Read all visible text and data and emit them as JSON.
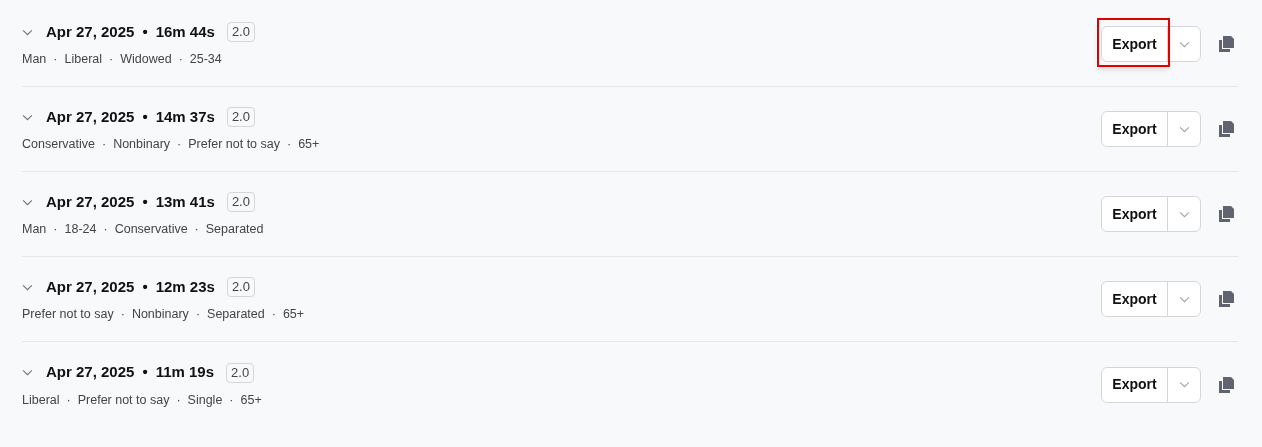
{
  "title_separator": "•",
  "tag_separator": "·",
  "sessions": [
    {
      "date": "Apr 27, 2025",
      "duration": "16m 44s",
      "version": "2.0",
      "tags": [
        "Man",
        "Liberal",
        "Widowed",
        "25-34"
      ],
      "export_label": "Export",
      "highlighted": true
    },
    {
      "date": "Apr 27, 2025",
      "duration": "14m 37s",
      "version": "2.0",
      "tags": [
        "Conservative",
        "Nonbinary",
        "Prefer not to say",
        "65+"
      ],
      "export_label": "Export",
      "highlighted": false
    },
    {
      "date": "Apr 27, 2025",
      "duration": "13m 41s",
      "version": "2.0",
      "tags": [
        "Man",
        "18-24",
        "Conservative",
        "Separated"
      ],
      "export_label": "Export",
      "highlighted": false
    },
    {
      "date": "Apr 27, 2025",
      "duration": "12m 23s",
      "version": "2.0",
      "tags": [
        "Prefer not to say",
        "Nonbinary",
        "Separated",
        "65+"
      ],
      "export_label": "Export",
      "highlighted": false
    },
    {
      "date": "Apr 27, 2025",
      "duration": "11m 19s",
      "version": "2.0",
      "tags": [
        "Liberal",
        "Prefer not to say",
        "Single",
        "65+"
      ],
      "export_label": "Export",
      "highlighted": false
    }
  ]
}
